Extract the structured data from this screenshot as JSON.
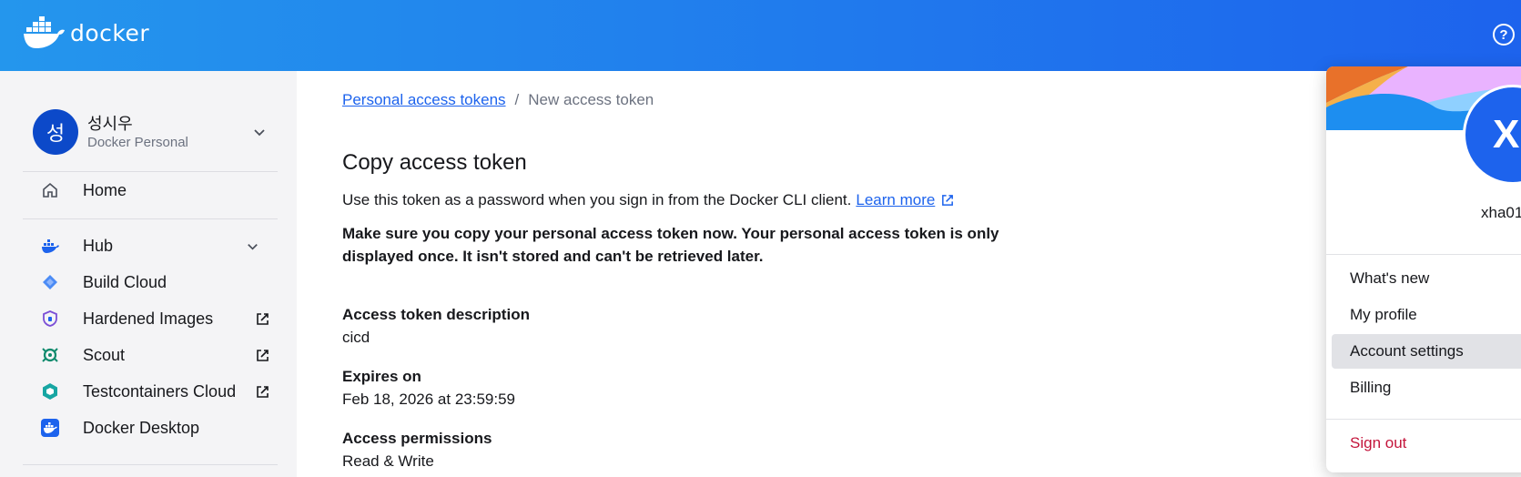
{
  "header": {
    "logo_text": "docker",
    "brand_color": "#1d63ed",
    "help_icon": "help-icon"
  },
  "sidebar": {
    "org": {
      "avatar_initial": "성",
      "name": "성시우",
      "type": "Docker Personal"
    },
    "items": [
      {
        "label": "Home",
        "icon": "home-icon"
      },
      {
        "label": "Hub",
        "icon": "hub-whale-icon"
      },
      {
        "label": "Build Cloud",
        "icon": "build-cloud-icon"
      },
      {
        "label": "Hardened Images",
        "icon": "hardened-images-icon"
      },
      {
        "label": "Scout",
        "icon": "scout-icon"
      },
      {
        "label": "Testcontainers Cloud",
        "icon": "testcontainers-icon"
      },
      {
        "label": "Docker Desktop",
        "icon": "docker-desktop-icon"
      }
    ]
  },
  "breadcrumb": {
    "parent": "Personal access tokens",
    "separator": "/",
    "current": "New access token"
  },
  "main": {
    "title": "Copy access token",
    "intro": "Use this token as a password when you sign in from the Docker CLI client.",
    "learn_more": "Learn more",
    "warning": "Make sure you copy your personal access token now. Your personal access token is only displayed once. It isn't stored and can't be retrieved later.",
    "fields": [
      {
        "label": "Access token description",
        "value": "cicd"
      },
      {
        "label": "Expires on",
        "value": "Feb 18, 2026 at 23:59:59"
      },
      {
        "label": "Access permissions",
        "value": "Read & Write"
      }
    ]
  },
  "account_menu": {
    "avatar_initial": "X",
    "username": "xha01",
    "items": [
      "What's new",
      "My profile",
      "Account settings",
      "Billing"
    ],
    "active_item": "Account settings",
    "sign_out": "Sign out",
    "sign_out_color": "#c4153b"
  }
}
